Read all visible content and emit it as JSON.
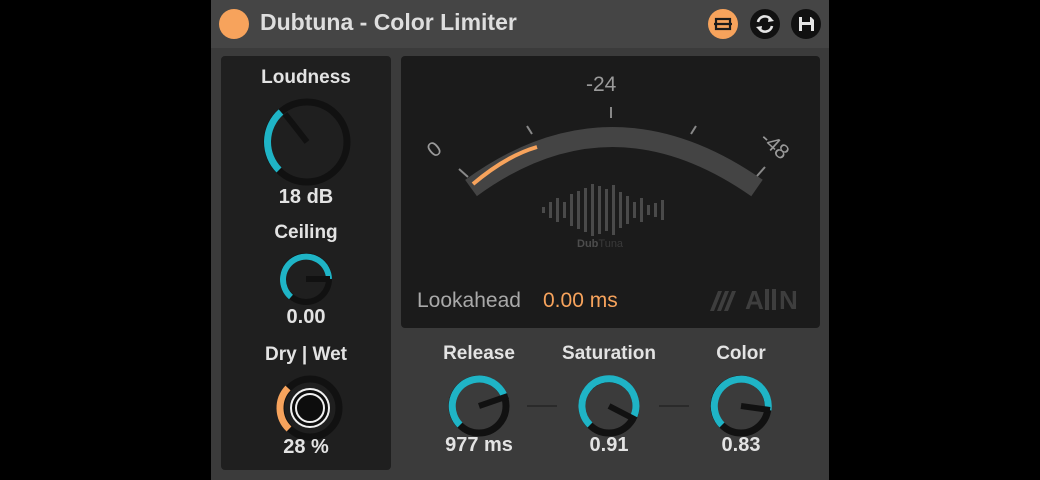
{
  "window": {
    "title": "Dubtuna - Color Limiter"
  },
  "icons": {
    "power": "power-toggle",
    "icon_1": "expand-icon",
    "icon_2": "swap-icon",
    "icon_3": "save-icon"
  },
  "colors": {
    "accent_teal": "#1fb4c6",
    "accent_orange": "#f7a35c",
    "panel_bg": "#1f1f1f",
    "device_bg": "#3b3b3b"
  },
  "left": {
    "loudness": {
      "label": "Loudness",
      "value": "18 dB"
    },
    "ceiling": {
      "label": "Ceiling",
      "value": "0.00"
    },
    "drywet": {
      "label": "Dry | Wet",
      "value": "28 %"
    }
  },
  "meter": {
    "scale": {
      "left": "0",
      "middle": "-24",
      "right": "-48"
    },
    "brand_a": "Dub",
    "brand_b": "Tuna",
    "logo": "///AIIN",
    "lookahead": {
      "label": "Lookahead",
      "value": "0.00 ms"
    }
  },
  "bottom": {
    "release": {
      "label": "Release",
      "value": "977 ms"
    },
    "saturation": {
      "label": "Saturation",
      "value": "0.91"
    },
    "color": {
      "label": "Color",
      "value": "0.83"
    }
  }
}
